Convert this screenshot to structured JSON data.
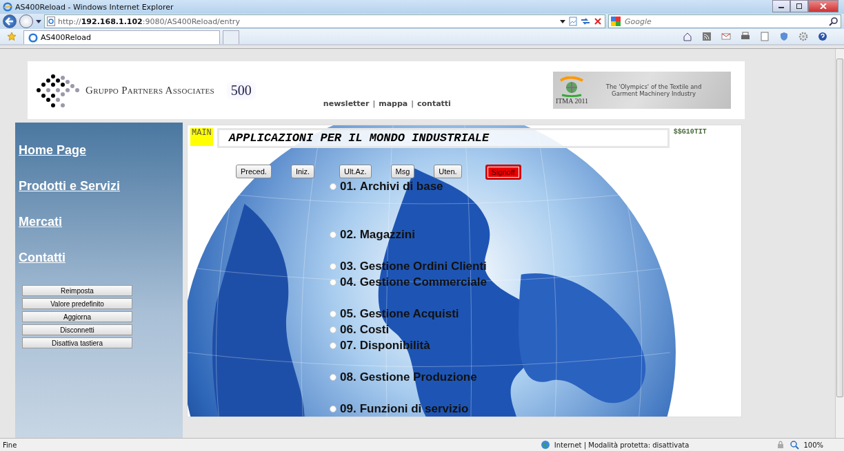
{
  "window": {
    "title": "AS400Reload - Windows Internet Explorer"
  },
  "address_bar": {
    "url_prefix": "http://",
    "url_host": "192.168.1.102",
    "url_rest": ":9080/AS400Reload/entry"
  },
  "search": {
    "placeholder": "Google"
  },
  "tabs": [
    {
      "label": "AS400Reload",
      "selected": true
    }
  ],
  "header": {
    "company": "Gruppo Partners Associates",
    "badge": "500",
    "links": [
      "newsletter",
      "mappa",
      "contatti"
    ],
    "link_separator": "|",
    "banner_title": "ITMA 2011",
    "banner_text": "The 'Olympics' of the Textile and Garment Machinery Industry"
  },
  "sidebar": {
    "links": [
      "Home Page",
      "Prodotti e Servizi",
      "Mercati",
      "Contatti"
    ],
    "buttons": [
      "Reimposta",
      "Valore predefinito",
      "Aggiorna",
      "Disconnetti",
      "Disattiva tastiera"
    ]
  },
  "main": {
    "tag": "MAIN",
    "title": "APPLICAZIONI PER IL MONDO INDUSTRIALE",
    "code": "$$G10TIT",
    "buttons": [
      {
        "label": "Preced.",
        "kind": "normal"
      },
      {
        "label": "Iniz.",
        "kind": "normal"
      },
      {
        "label": "Ult.Az.",
        "kind": "normal"
      },
      {
        "label": "Msg",
        "kind": "normal"
      },
      {
        "label": "Uten.",
        "kind": "normal"
      },
      {
        "label": "Signoff",
        "kind": "danger"
      }
    ],
    "menu_groups": [
      {
        "items": [
          {
            "number": "01.",
            "label": "Archivi di base",
            "selected": false
          }
        ]
      },
      {
        "items": [
          {
            "number": "02.",
            "label": "Magazzini",
            "selected": false
          }
        ]
      },
      {
        "items": [
          {
            "number": "03.",
            "label": "Gestione Ordini Clienti",
            "selected": false
          },
          {
            "number": "04.",
            "label": "Gestione Commerciale",
            "selected": false
          }
        ]
      },
      {
        "items": [
          {
            "number": "05.",
            "label": "Gestione Acquisti",
            "selected": false
          },
          {
            "number": "06.",
            "label": "Costi",
            "selected": false
          },
          {
            "number": "07.",
            "label": "Disponibilità",
            "selected": false
          }
        ]
      },
      {
        "items": [
          {
            "number": "08.",
            "label": "Gestione Produzione",
            "selected": false
          }
        ]
      },
      {
        "items": [
          {
            "number": "09.",
            "label": "Funzioni di servizio",
            "selected": false
          }
        ]
      }
    ]
  },
  "status_bar": {
    "text": "Fine",
    "zone": "Internet | Modalità protetta: disattivata",
    "zoom": "100%"
  }
}
